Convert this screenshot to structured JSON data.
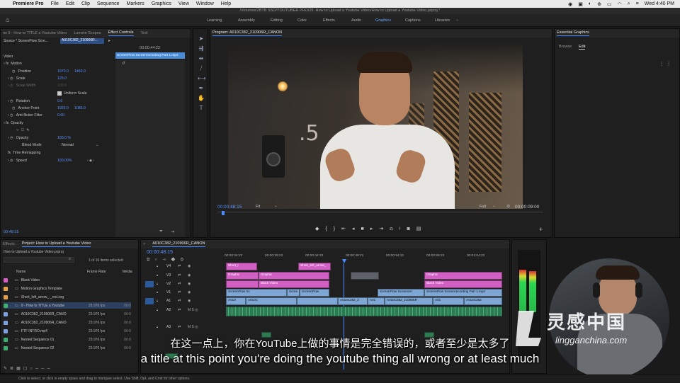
{
  "menubar": {
    "app": "Premiere Pro",
    "items": [
      "File",
      "Edit",
      "Clip",
      "Sequence",
      "Markers",
      "Graphics",
      "View",
      "Window",
      "Help"
    ],
    "clock": "Wed 4:40 PM"
  },
  "window_title": "/Volumes/2BTB SSD/YOUTUBER PRO/29. How to Upload a Youtube Video/How to Upload a Youtube Video.prproj *",
  "workspaces": [
    "Learning",
    "Assembly",
    "Editing",
    "Color",
    "Effects",
    "Audio",
    "Graphics",
    "Captions",
    "Libraries"
  ],
  "active_workspace": "Graphics",
  "source_panel": {
    "tabs": [
      "ns 9 - How to TITLE a Youtube Video",
      "Lumetri Scopes",
      "Effect Controls",
      "Text"
    ],
    "active_tab": "Effect Controls",
    "source_label": "Source * ScreenFlow Scre...",
    "clip_label": "A010C382_210906R...",
    "timecode": "00:00:44:22",
    "clip_bar": "ScreenFlow Screenrecording Part 1.mp4",
    "video_header": "Video",
    "motion": "Motion",
    "position_label": "Position",
    "position_x": "1970.0",
    "position_y": "1463.0",
    "scale_label": "Scale",
    "scale": "125.0",
    "scale_width_label": "Scale Width",
    "scale_width": "100.0",
    "uniform_scale": "Uniform Scale",
    "rotation_label": "Rotation",
    "rotation": "0.0",
    "anchor_label": "Anchor Point",
    "anchor_x": "1920.0",
    "anchor_y": "1080.0",
    "flicker_label": "Anti-flicker Filter",
    "flicker": "0.00",
    "opacity_header": "Opacity",
    "opacity_label": "Opacity",
    "opacity": "100.0 %",
    "blend_label": "Blend Mode",
    "blend": "Normal",
    "remap_header": "Time Remapping",
    "speed_label": "Speed",
    "speed": "100.00%",
    "footer_time": "00:48:15"
  },
  "program": {
    "title": "Program: A010C382_210906R_CANON",
    "timecode": "00:00:48:15",
    "fit": "Fit",
    "quality": "Full",
    "duration": "00:00:09:00"
  },
  "essential_graphics": {
    "title": "Essential Graphics",
    "tabs": [
      "Browse",
      "Edit"
    ],
    "active_tab": "Edit"
  },
  "project": {
    "tabs": [
      "Effects",
      "Project: How to Upload a Youtube Video"
    ],
    "active_tab": "Project: How to Upload a Youtube Video",
    "file": "How to Upload a Youtube Video.prproj",
    "count": "1 of 16 items selected",
    "col_name": "Name",
    "col_rate": "Frame Rate",
    "col_media": "Media",
    "items": [
      {
        "name": "Black Video",
        "rate": "",
        "media": "",
        "color": "#e05ad0"
      },
      {
        "name": "Motion Graphics Template",
        "rate": "",
        "media": "",
        "color": "#e8a040"
      },
      {
        "name": "Short_left_arrow_-_red.svg",
        "rate": "",
        "media": "",
        "color": "#e8a040"
      },
      {
        "name": "9 - How to TITLE a Youtube",
        "rate": "23.976 fps",
        "media": "00:0",
        "color": "#39b26c"
      },
      {
        "name": "A010C382_210906R_CANO",
        "rate": "23.976 fps",
        "media": "00:0",
        "color": "#7aa0e0"
      },
      {
        "name": "A010C382_210906R_CANO",
        "rate": "23.976 fps",
        "media": "00:0",
        "color": "#7aa0e0"
      },
      {
        "name": "FTF INTRO.mp4",
        "rate": "23.976 fps",
        "media": "00:0",
        "color": "#7aa0e0"
      },
      {
        "name": "Nested Sequence 01",
        "rate": "23.976 fps",
        "media": "00:0",
        "color": "#39b26c"
      },
      {
        "name": "Nested Sequence 02",
        "rate": "23.976 fps",
        "media": "00:0",
        "color": "#39b26c"
      }
    ]
  },
  "timeline": {
    "title": "A010C382_210906R_CANON",
    "timecode": "00:00:48:15",
    "ruler": [
      "00:00:34:23",
      "00:00:39:23",
      "00:00:44:22",
      "00:00:49:21",
      "00:00:54:21",
      "00:00:59:22",
      "00:01:04:22"
    ],
    "tracks": [
      "V4",
      "V3",
      "V2",
      "V1",
      "A1",
      "A2",
      "A3"
    ],
    "clips": {
      "short1": "Short_l",
      "short2": "Short_left_arrow_",
      "graphic1": "Graphic",
      "graphic2": "Graphic",
      "black1": "Black Video",
      "black2": "Black Video",
      "graphic3": "Graphic",
      "screen1": "ScreenFlow Sc",
      "screen2": "Scree",
      "screen3": "ScreenFlow",
      "screen4": "ScreenFlow Screenrec",
      "screen5": "ScreenFlow Screenrecording Part 1.mp4",
      "a1": "A010",
      "a2": "A010C",
      "a3": "A010C382_2",
      "a4": "A01",
      "a5": "A010C382_210906R",
      "a6": "A01",
      "a7": "A010C382"
    }
  },
  "subtitles": {
    "zh": "在这一点上，你在YouTube上做的事情是完全错误的，或者至少是太多了",
    "en": "a title at this point you're doing the youtube thing all wrong or at least much"
  },
  "watermark": {
    "name": "灵感中国",
    "url": "lingganchina.com"
  },
  "status": "Click to select, or click in empty space and drag to marquee select. Use Shift, Opt, and Cmd for other options."
}
